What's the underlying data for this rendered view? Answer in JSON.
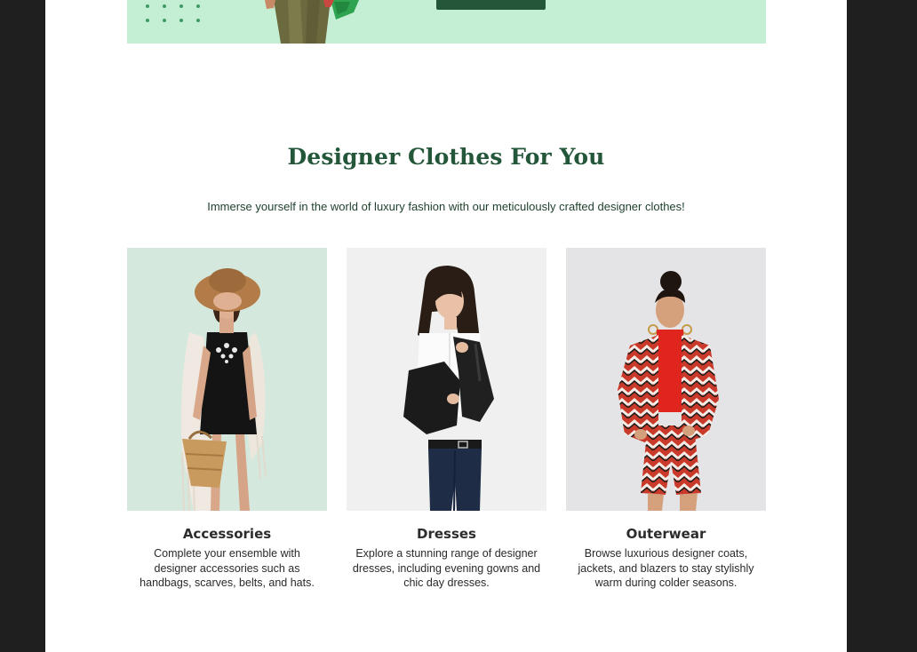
{
  "hero": {
    "button_label": ""
  },
  "section": {
    "title": "Designer Clothes For You",
    "subtitle": "Immerse yourself in the world of luxury fashion with our meticulously crafted designer clothes!"
  },
  "cards": [
    {
      "title": "Accessories",
      "description": "Complete your ensemble with designer accessories such as handbags, scarves, belts, and hats.",
      "image_bg": "#d5e8de"
    },
    {
      "title": "Dresses",
      "description": "Explore a stunning range of designer dresses, including evening gowns and chic day dresses.",
      "image_bg": "#f0f0f0"
    },
    {
      "title": "Outerwear",
      "description": "Browse luxurious designer coats, jackets, and blazers to stay stylishly warm during colder seasons.",
      "image_bg": "#e4e4e6"
    }
  ],
  "colors": {
    "brand_green": "#24573a",
    "hero_bg": "#c5efd4",
    "page_bg": "#ffffff",
    "outer_bg": "#1f1f1f"
  }
}
